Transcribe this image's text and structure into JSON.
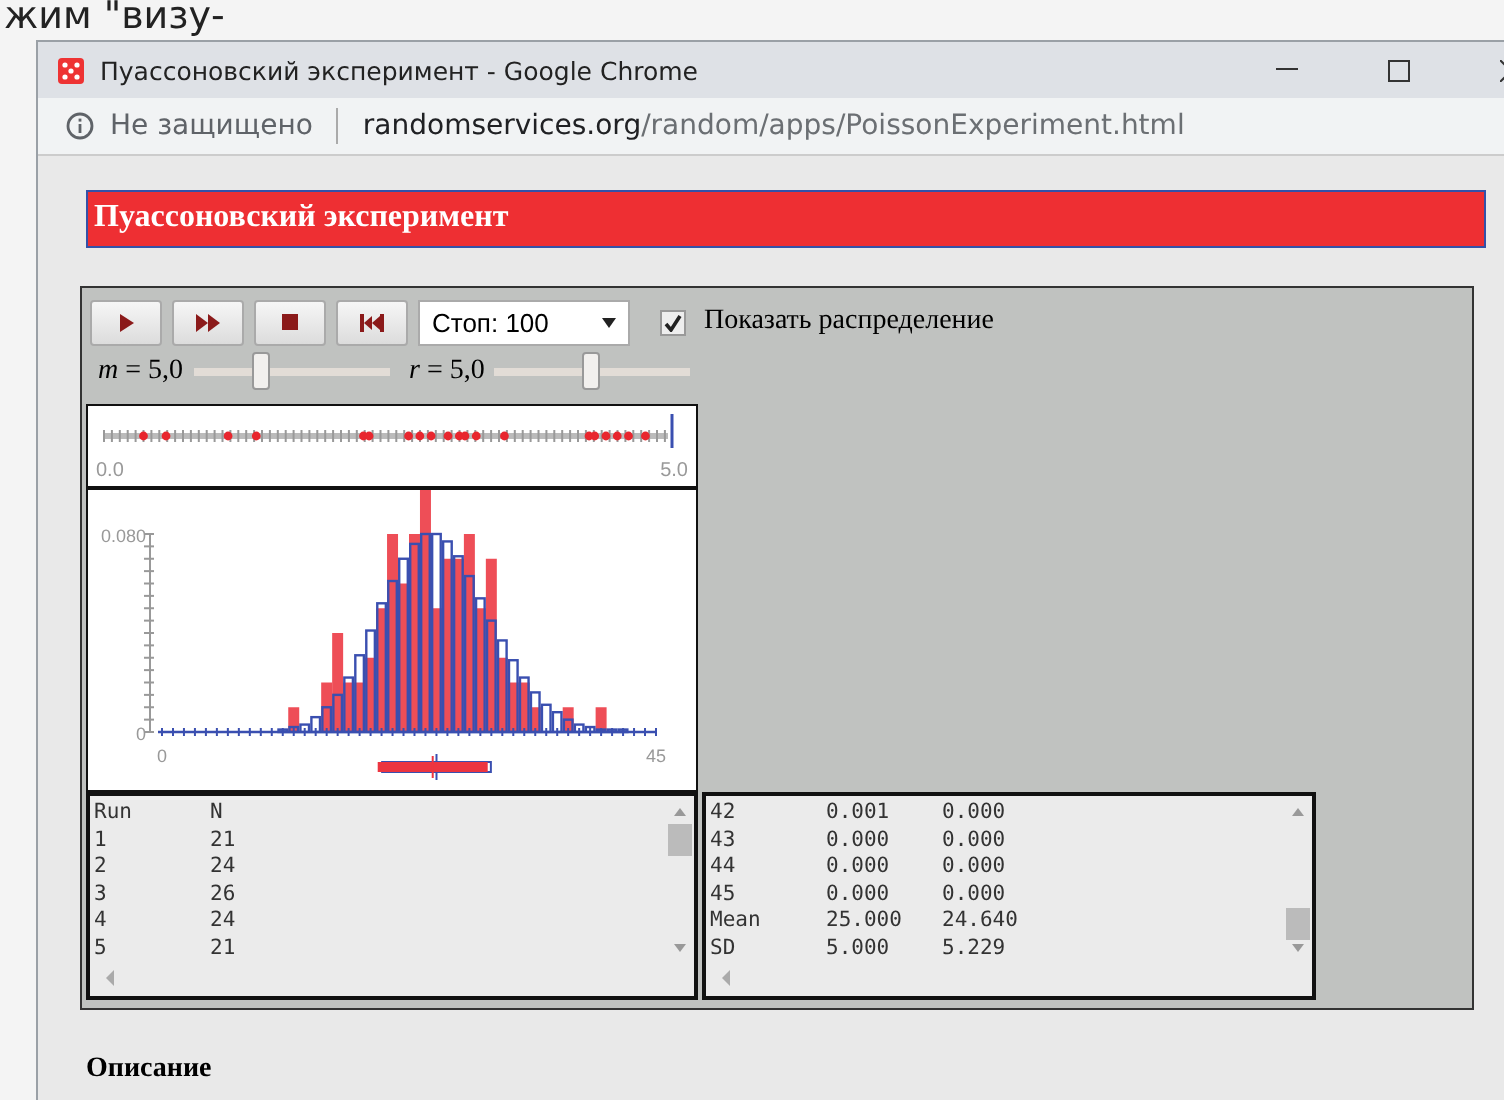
{
  "background_text": "жим \"визу-",
  "window": {
    "title": "Пуассоновский эксперимент - Google Chrome"
  },
  "address_bar": {
    "security": "Не защищено",
    "url_host": "randomservices.org",
    "url_path": "/random/apps/PoissonExperiment.html"
  },
  "page": {
    "heading": "Пуассоновский эксперимент",
    "toolbar": {
      "buttons": [
        {
          "kind": "step"
        },
        {
          "kind": "run"
        },
        {
          "kind": "stop"
        },
        {
          "kind": "reset"
        }
      ],
      "stop_select": {
        "value": "Стоп: 100"
      },
      "show_distribution": {
        "label": "Показать распределение",
        "checked": true
      }
    },
    "sliders": [
      {
        "label": "*m* = 5,0",
        "level": 0.35
      },
      {
        "label": "*r* = 5,0",
        "level": 0.5
      }
    ],
    "timeline": {
      "start_label": "0.0",
      "end_label": "5.0"
    },
    "chart_data": {
      "type": "bar",
      "x": [
        0,
        1,
        2,
        3,
        4,
        5,
        6,
        7,
        8,
        9,
        10,
        11,
        12,
        13,
        14,
        15,
        16,
        17,
        18,
        19,
        20,
        21,
        22,
        23,
        24,
        25,
        26,
        27,
        28,
        29,
        30,
        31,
        32,
        33,
        34,
        35,
        36,
        37,
        38,
        39,
        40,
        41,
        42,
        43,
        44,
        45
      ],
      "series": [
        {
          "color": "#3a4fb0",
          "values": [
            0,
            0,
            0,
            0,
            0,
            0,
            0,
            0,
            0,
            0,
            0,
            0.001,
            0.002,
            0.003,
            0.006,
            0.01,
            0.015,
            0.022,
            0.031,
            0.041,
            0.052,
            0.061,
            0.07,
            0.076,
            0.08,
            0.08,
            0.077,
            0.071,
            0.063,
            0.054,
            0.045,
            0.037,
            0.029,
            0.022,
            0.016,
            0.011,
            0.008,
            0.005,
            0.003,
            0.002,
            0.001,
            0.001,
            0.001,
            0,
            0,
            0
          ]
        },
        {
          "color": "#ec3540",
          "values": [
            0,
            0,
            0,
            0,
            0,
            0,
            0,
            0,
            0,
            0,
            0,
            0,
            0.01,
            0,
            0,
            0.02,
            0.04,
            0.02,
            0.02,
            0.03,
            0.05,
            0.08,
            0.06,
            0.08,
            0.1,
            0.05,
            0.07,
            0.07,
            0.08,
            0.05,
            0.07,
            0.03,
            0.02,
            0.02,
            0.01,
            0,
            0,
            0.01,
            0,
            0,
            0.01,
            0,
            0,
            0,
            0,
            0
          ]
        }
      ],
      "xlim": [
        0,
        45
      ],
      "ylim": [
        0,
        0.1
      ],
      "xticks": [
        0,
        45
      ],
      "yticks": [
        0,
        {
          "value": 0.08,
          "label": "0.080"
        }
      ]
    },
    "run_table": {
      "header": [
        "Run",
        "N"
      ],
      "rows": [
        [
          "1",
          "21"
        ],
        [
          "2",
          "24"
        ],
        [
          "3",
          "26"
        ],
        [
          "4",
          "24"
        ],
        [
          "5",
          "21"
        ]
      ]
    },
    "distribution_table": {
      "rows": [
        [
          "42",
          "0.001",
          "0.000"
        ],
        [
          "43",
          "0.000",
          "0.000"
        ],
        [
          "44",
          "0.000",
          "0.000"
        ],
        [
          "45",
          "0.000",
          "0.000"
        ],
        [
          "Mean",
          "25.000",
          "24.640"
        ],
        [
          "SD",
          "5.000",
          "5.229"
        ]
      ]
    },
    "section_heading": "Описание"
  }
}
